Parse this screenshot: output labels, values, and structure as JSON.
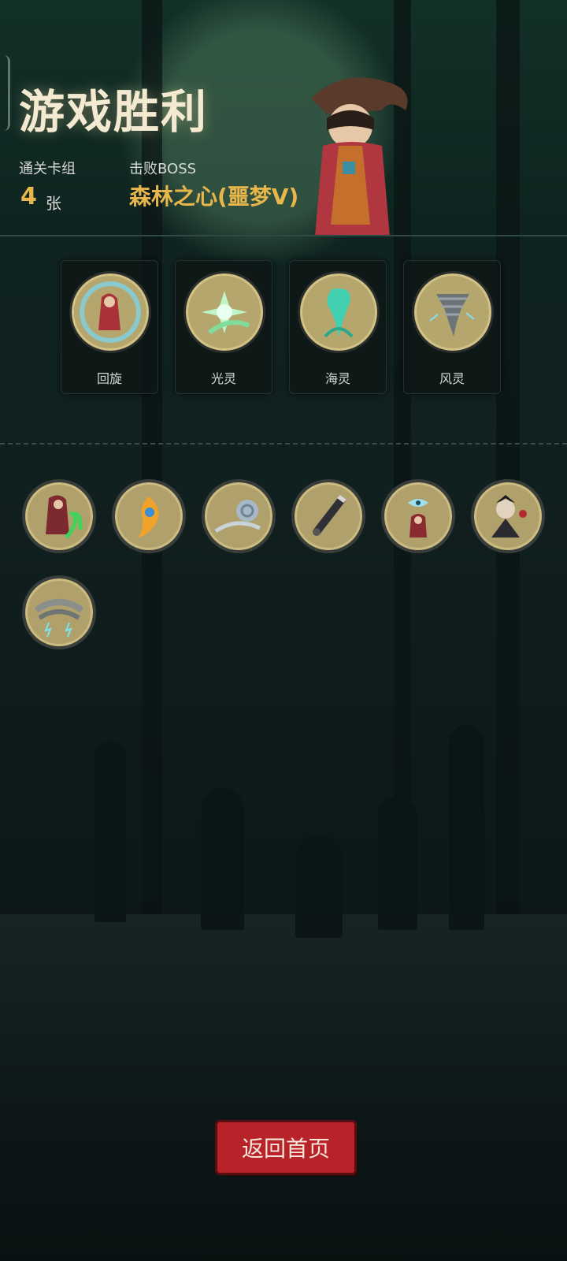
{
  "header": {
    "title": "游戏胜利",
    "cards_label": "通关卡组",
    "cards_count": "4",
    "cards_unit": "张",
    "boss_label": "击败BOSS",
    "boss_name": "森林之心(噩梦V)"
  },
  "cards": [
    {
      "label": "回旋",
      "icon": "whirl-witch-icon"
    },
    {
      "label": "光灵",
      "icon": "light-spirit-icon"
    },
    {
      "label": "海灵",
      "icon": "sea-spirit-icon"
    },
    {
      "label": "风灵",
      "icon": "wind-spirit-icon"
    }
  ],
  "relics": [
    {
      "icon": "red-hood-green-vine-icon"
    },
    {
      "icon": "phoenix-feather-icon"
    },
    {
      "icon": "smoke-spiral-icon"
    },
    {
      "icon": "dark-dagger-icon"
    },
    {
      "icon": "eye-shrine-icon"
    },
    {
      "icon": "vampire-icon"
    },
    {
      "icon": "storm-cloud-icon"
    }
  ],
  "footer": {
    "back_label": "返回首页"
  },
  "colors": {
    "accent_gold": "#e8b64a",
    "button_red": "#b8232a",
    "background": "#0f1b1b"
  }
}
